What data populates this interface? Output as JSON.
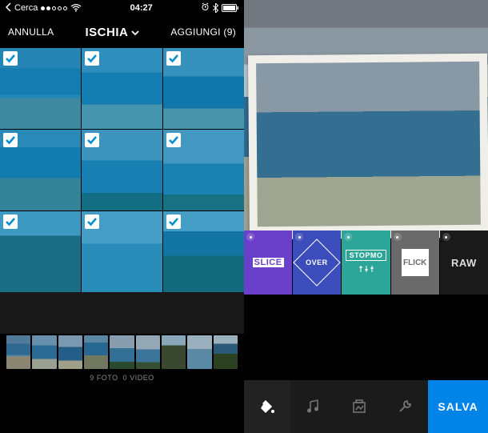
{
  "status": {
    "back_label": "Cerca",
    "time": "04:27"
  },
  "nav": {
    "cancel": "ANNULLA",
    "title": "ISCHIA",
    "add": "AGGIUNGI",
    "add_count": "(9)"
  },
  "counter": {
    "photos_count": "9",
    "photos_label": "FOTO",
    "videos_count": "0",
    "videos_label": "VIDEO"
  },
  "effects": {
    "slice": "SLICE",
    "over": "OVER",
    "stopmo": "STOPMO",
    "flick": "FLICK",
    "raw": "RAW"
  },
  "toolbar": {
    "save": "SALVA"
  }
}
